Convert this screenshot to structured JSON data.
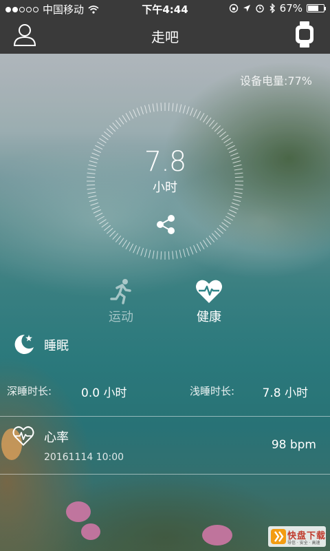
{
  "status_bar": {
    "carrier": "中国移动",
    "time": "下午4:44",
    "battery_percent": "67%",
    "battery_fill": 0.67,
    "signal_dots_filled": 2,
    "signal_dots_total": 5
  },
  "nav": {
    "title": "走吧",
    "left_icon": "user-icon",
    "right_icon": "watch-icon"
  },
  "device_battery": "设备电量:77%",
  "dial": {
    "value": "7.8",
    "unit": "小时",
    "share_icon": "share-icon"
  },
  "tabs": [
    {
      "label": "运动",
      "icon": "running-icon",
      "active": false
    },
    {
      "label": "健康",
      "icon": "heart-pulse-icon",
      "active": true
    }
  ],
  "sleep": {
    "title": "睡眠",
    "icon": "moon-star-icon",
    "deep_label": "深睡时长:",
    "deep_value": "0.0 小时",
    "light_label": "浅睡时长:",
    "light_value": "7.8 小时"
  },
  "heart_rate": {
    "title": "心率",
    "icon": "heart-rate-icon",
    "date": "20161114 10:00",
    "value": "98 bpm"
  },
  "watermark": {
    "big_text": "快盘下载",
    "small_text": "导信 · 安全 · 高速"
  },
  "colors": {
    "nav_bg": "#3a3a3a",
    "text": "#ffffff"
  }
}
